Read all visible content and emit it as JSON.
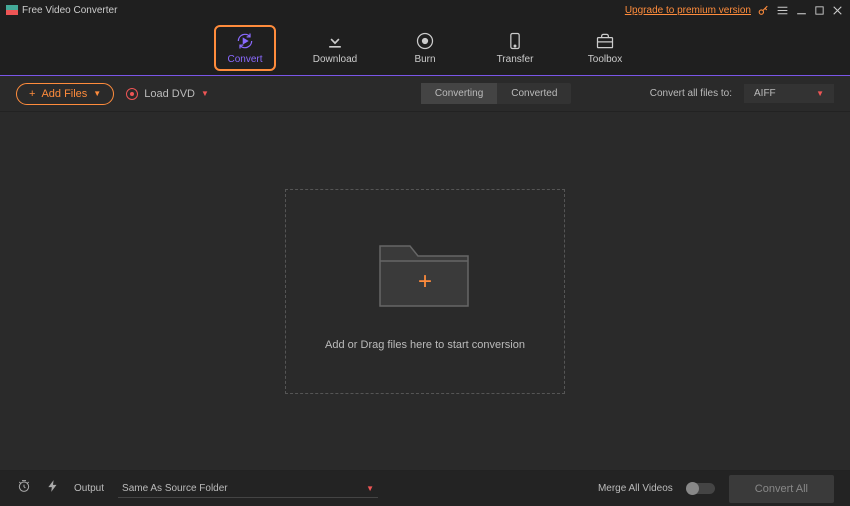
{
  "titlebar": {
    "app_name": "Free Video Converter",
    "premium_link": "Upgrade to premium version"
  },
  "nav": {
    "convert": "Convert",
    "download": "Download",
    "burn": "Burn",
    "transfer": "Transfer",
    "toolbox": "Toolbox"
  },
  "toolbar": {
    "add_files": "Add Files",
    "load_dvd": "Load DVD",
    "seg_converting": "Converting",
    "seg_converted": "Converted",
    "convert_all_label": "Convert all files to:",
    "format_value": "AIFF"
  },
  "dropzone": {
    "hint": "Add or Drag files here to start conversion"
  },
  "footer": {
    "output_label": "Output",
    "output_path": "Same As Source Folder",
    "merge_label": "Merge All Videos",
    "convert_all": "Convert All"
  }
}
